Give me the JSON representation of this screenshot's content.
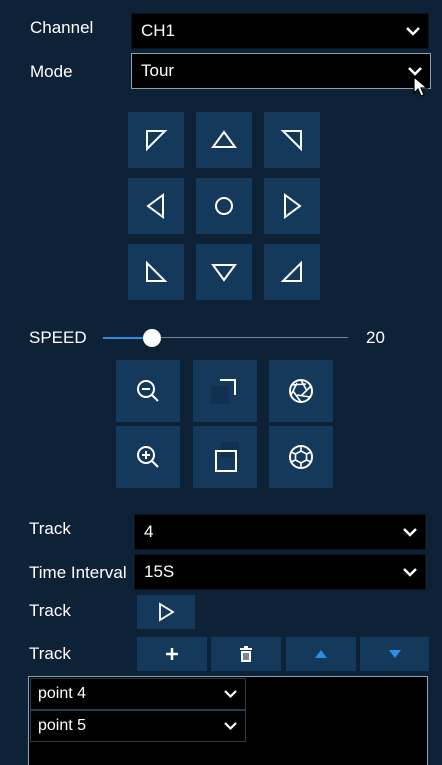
{
  "channel": {
    "label": "Channel",
    "value": "CH1"
  },
  "mode": {
    "label": "Mode",
    "value": "Tour"
  },
  "speed": {
    "label": "SPEED",
    "value": "20",
    "level": 0.2
  },
  "track_count": {
    "label": "Track",
    "value": "4"
  },
  "time_interval": {
    "label": "Time Interval",
    "value": "15S"
  },
  "track_play": {
    "label": "Track"
  },
  "track_edit": {
    "label": "Track"
  },
  "points": [
    "point 4",
    "point 5"
  ],
  "colors": {
    "background": "#0d2236",
    "button": "#14395b",
    "accent": "#2a8de8",
    "field": "#000000"
  }
}
